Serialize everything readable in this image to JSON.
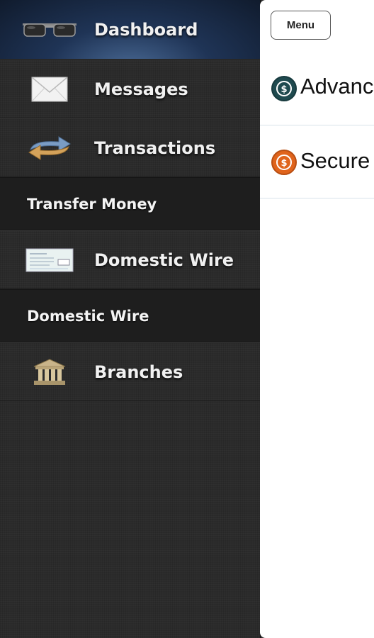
{
  "sidebar": {
    "items": [
      {
        "label": "Dashboard",
        "icon": "sunglasses-icon"
      },
      {
        "label": "Messages",
        "icon": "envelope-icon"
      },
      {
        "label": "Transactions",
        "icon": "transfer-arrows-icon"
      },
      {
        "label": "Transfer Money",
        "type": "section-header"
      },
      {
        "label": "Domestic Wire",
        "icon": "check-icon"
      },
      {
        "label": "Domestic Wire",
        "type": "section-header"
      },
      {
        "label": "Branches",
        "icon": "bank-building-icon"
      }
    ]
  },
  "main": {
    "menu_label": "Menu",
    "rows": [
      {
        "label": "Advanc",
        "coin_color": "#1f4a4f"
      },
      {
        "label": "Secure",
        "coin_color": "#e0641c"
      }
    ]
  },
  "colors": {
    "active_item": "#1f3456",
    "sidebar_bg": "#2b2b2b",
    "section_bg": "#1e1e1e"
  }
}
